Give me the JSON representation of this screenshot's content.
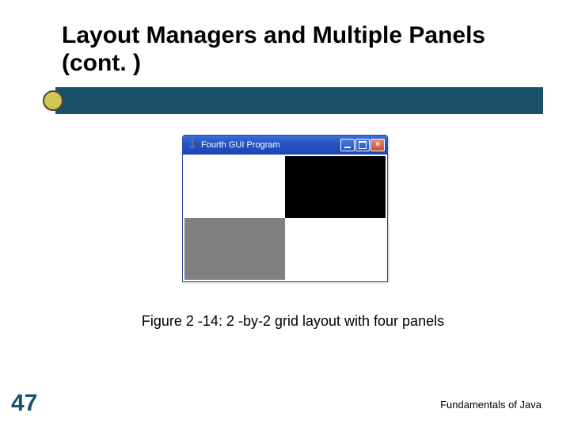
{
  "title": "Layout Managers and Multiple Panels (cont. )",
  "window": {
    "title": "Fourth GUI Program",
    "close_label": "×"
  },
  "caption": "Figure 2 -14: 2 -by-2 grid layout with four panels",
  "slide_number": "47",
  "footer": "Fundamentals of Java"
}
